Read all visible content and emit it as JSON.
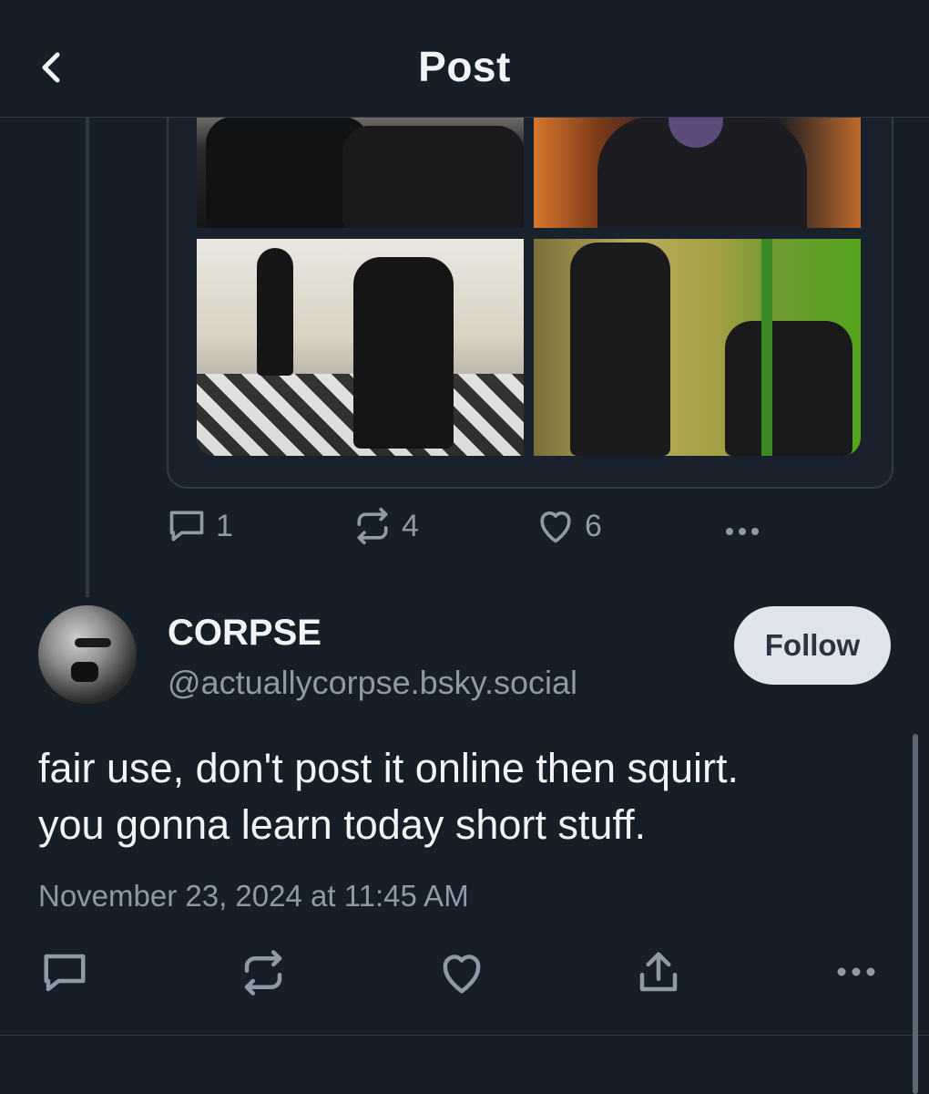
{
  "header": {
    "title": "Post",
    "back_icon": "chevron-left-icon"
  },
  "parent_post": {
    "images": [
      {
        "name": "image-1"
      },
      {
        "name": "image-2"
      },
      {
        "name": "image-3"
      },
      {
        "name": "image-4"
      }
    ],
    "stats": {
      "replies": "1",
      "reposts": "4",
      "likes": "6"
    }
  },
  "author": {
    "display_name": "CORPSE",
    "handle": "@actuallycorpse.bsky.social",
    "follow_label": "Follow"
  },
  "post": {
    "text_line1": "fair use, don't post it online then squirt.",
    "text_line2": "you gonna learn today short stuff.",
    "timestamp": "November 23, 2024 at 11:45 AM"
  },
  "colors": {
    "background": "#161e27",
    "muted": "#8f9aa8",
    "border": "#2e3a47",
    "follow_bg": "#dfe4ea"
  }
}
